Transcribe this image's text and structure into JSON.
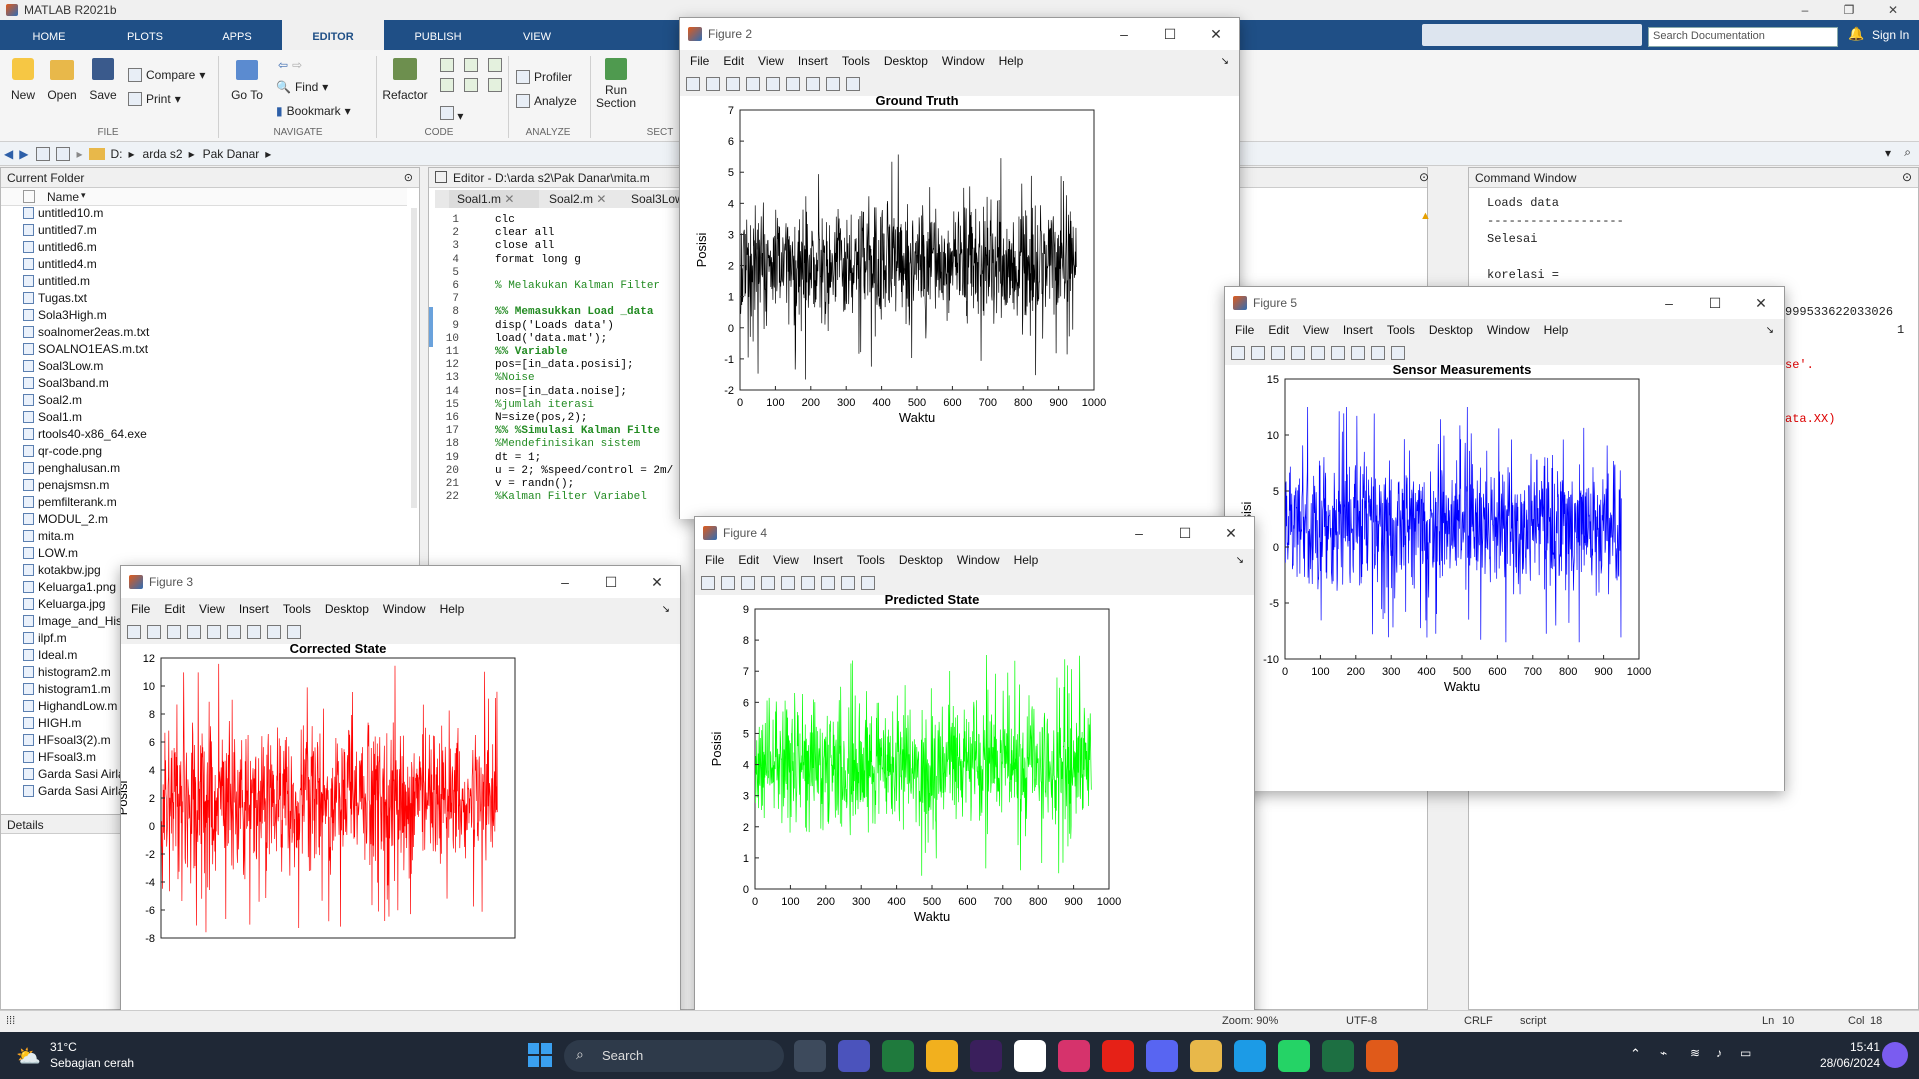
{
  "app": {
    "title": "MATLAB R2021b",
    "sign_in": "Sign In",
    "search_placeholder": "Search Documentation"
  },
  "tabs": [
    "HOME",
    "PLOTS",
    "APPS",
    "EDITOR",
    "PUBLISH",
    "VIEW"
  ],
  "ribbon": {
    "file": {
      "new": "New",
      "open": "Open",
      "save": "Save",
      "compare": "Compare",
      "print": "Print",
      "label": "FILE"
    },
    "navigate": {
      "goto": "Go To",
      "find": "Find",
      "bookmark": "Bookmark",
      "label": "NAVIGATE"
    },
    "code": {
      "refactor": "Refactor",
      "label": "CODE"
    },
    "analyze": {
      "profiler": "Profiler",
      "analyze": "Analyze",
      "label": "ANALYZE"
    },
    "section": {
      "run_section": "Run Section",
      "label": "SECT"
    }
  },
  "address": {
    "drive": "D:",
    "path": [
      "arda s2",
      "Pak Danar"
    ]
  },
  "current_folder": {
    "title": "Current Folder",
    "column": "Name",
    "files": [
      "untitled10.m",
      "untitled7.m",
      "untitled6.m",
      "untitled4.m",
      "untitled.m",
      "Tugas.txt",
      "Sola3High.m",
      "soalnomer2eas.m.txt",
      "SOALNO1EAS.m.txt",
      "Soal3Low.m",
      "Soal3band.m",
      "Soal2.m",
      "Soal1.m",
      "rtools40-x86_64.exe",
      "qr-code.png",
      "penghalusan.m",
      "penajsmsn.m",
      "pemfilterank.m",
      "MODUL_2.m",
      "mita.m",
      "LOW.m",
      "kotakbw.jpg",
      "Keluarga1.png",
      "Keluarga.jpg",
      "Image_and_His",
      "ilpf.m",
      "Ideal.m",
      "histogram2.m",
      "histogram1.m",
      "HighandLow.m",
      "HIGH.m",
      "HFsoal3(2).m",
      "HFsoal3.m",
      "Garda Sasi Airla",
      "Garda Sasi Airla"
    ],
    "details": "Details"
  },
  "editor": {
    "title": "Editor - D:\\arda s2\\Pak Danar\\mita.m",
    "tabs": [
      "Soal1.m",
      "Soal2.m",
      "Soal3Low."
    ],
    "lines": [
      "clc",
      "clear all",
      "close all",
      "format long g",
      "",
      "% Melakukan Kalman Filter",
      "",
      "%% Memasukkan Load _data",
      "disp('Loads data')",
      "load('data.mat');",
      "%% Variable",
      "pos=[in_data.posisi];",
      "%Noise",
      "nos=[in_data.noise];",
      "%jumlah iterasi",
      "N=size(pos,2);",
      "%% %Simulasi Kalman Filte",
      "%Mendefinisikan sistem",
      "dt = 1;",
      "u = 2; %speed/control = 2m/",
      "v = randn();",
      "%Kalman Filter Variabel"
    ]
  },
  "command_window": {
    "title": "Command Window",
    "lines": [
      "Loads data",
      "-------------------",
      "Selesai",
      "",
      "korelasi ="
    ],
    "fragments": [
      "999533622033026",
      "1",
      "se'.",
      "ata.XX)"
    ]
  },
  "figures": {
    "menu": [
      "File",
      "Edit",
      "View",
      "Insert",
      "Tools",
      "Desktop",
      "Window",
      "Help"
    ],
    "fig2": {
      "window": "Figure 2"
    },
    "fig3": {
      "window": "Figure 3"
    },
    "fig4": {
      "window": "Figure 4"
    },
    "fig5": {
      "window": "Figure 5"
    }
  },
  "chart_data": [
    {
      "id": "fig2",
      "type": "line",
      "title": "Ground Truth",
      "xlabel": "Waktu",
      "ylabel": "Posisi",
      "color": "#000000",
      "xlim": [
        0,
        1000
      ],
      "ylim": [
        -2,
        7
      ],
      "xticks": [
        0,
        100,
        200,
        300,
        400,
        500,
        600,
        700,
        800,
        900,
        1000
      ],
      "yticks": [
        -2,
        -1,
        0,
        1,
        2,
        3,
        4,
        5,
        6,
        7
      ],
      "n_points": 950,
      "center": 2,
      "spread": 1.0,
      "range": [
        -1.9,
        6.7
      ]
    },
    {
      "id": "fig3",
      "type": "line",
      "title": "Corrected State",
      "xlabel": "",
      "ylabel": "Posisi",
      "color": "#ff0000",
      "xlim": [
        0,
        1000
      ],
      "ylim": [
        -8,
        12
      ],
      "xticks": [],
      "yticks": [
        -8,
        -6,
        -4,
        -2,
        0,
        2,
        4,
        6,
        8,
        10,
        12
      ],
      "n_points": 950,
      "center": 2,
      "spread": 2.6,
      "range": [
        -7.8,
        11.6
      ]
    },
    {
      "id": "fig4",
      "type": "line",
      "title": "Predicted State",
      "xlabel": "Waktu",
      "ylabel": "Posisi",
      "color": "#00ff00",
      "xlim": [
        0,
        1000
      ],
      "ylim": [
        0,
        9
      ],
      "xticks": [
        0,
        100,
        200,
        300,
        400,
        500,
        600,
        700,
        800,
        900,
        1000
      ],
      "yticks": [
        0,
        1,
        2,
        3,
        4,
        5,
        6,
        7,
        8,
        9
      ],
      "n_points": 950,
      "center": 4,
      "spread": 1.0,
      "range": [
        0.1,
        8.8
      ]
    },
    {
      "id": "fig5",
      "type": "line",
      "title": "Sensor Measurements",
      "xlabel": "Waktu",
      "ylabel": "Posisi",
      "color": "#0000ff",
      "xlim": [
        0,
        1000
      ],
      "ylim": [
        -10,
        15
      ],
      "xticks": [
        0,
        100,
        200,
        300,
        400,
        500,
        600,
        700,
        800,
        900,
        1000
      ],
      "yticks": [
        -10,
        -5,
        0,
        5,
        10,
        15
      ],
      "n_points": 950,
      "center": 2,
      "spread": 3.0,
      "range": [
        -8.5,
        12.5
      ]
    }
  ],
  "statusbar": {
    "zoom": "Zoom: 90%",
    "encoding": "UTF-8",
    "eol": "CRLF",
    "type": "script",
    "ln_label": "Ln",
    "ln": "10",
    "col_label": "Col",
    "col": "18"
  },
  "taskbar": {
    "weather_temp": "31°C",
    "weather_desc": "Sebagian cerah",
    "search": "Search",
    "time": "15:41",
    "date": "28/06/2024"
  }
}
